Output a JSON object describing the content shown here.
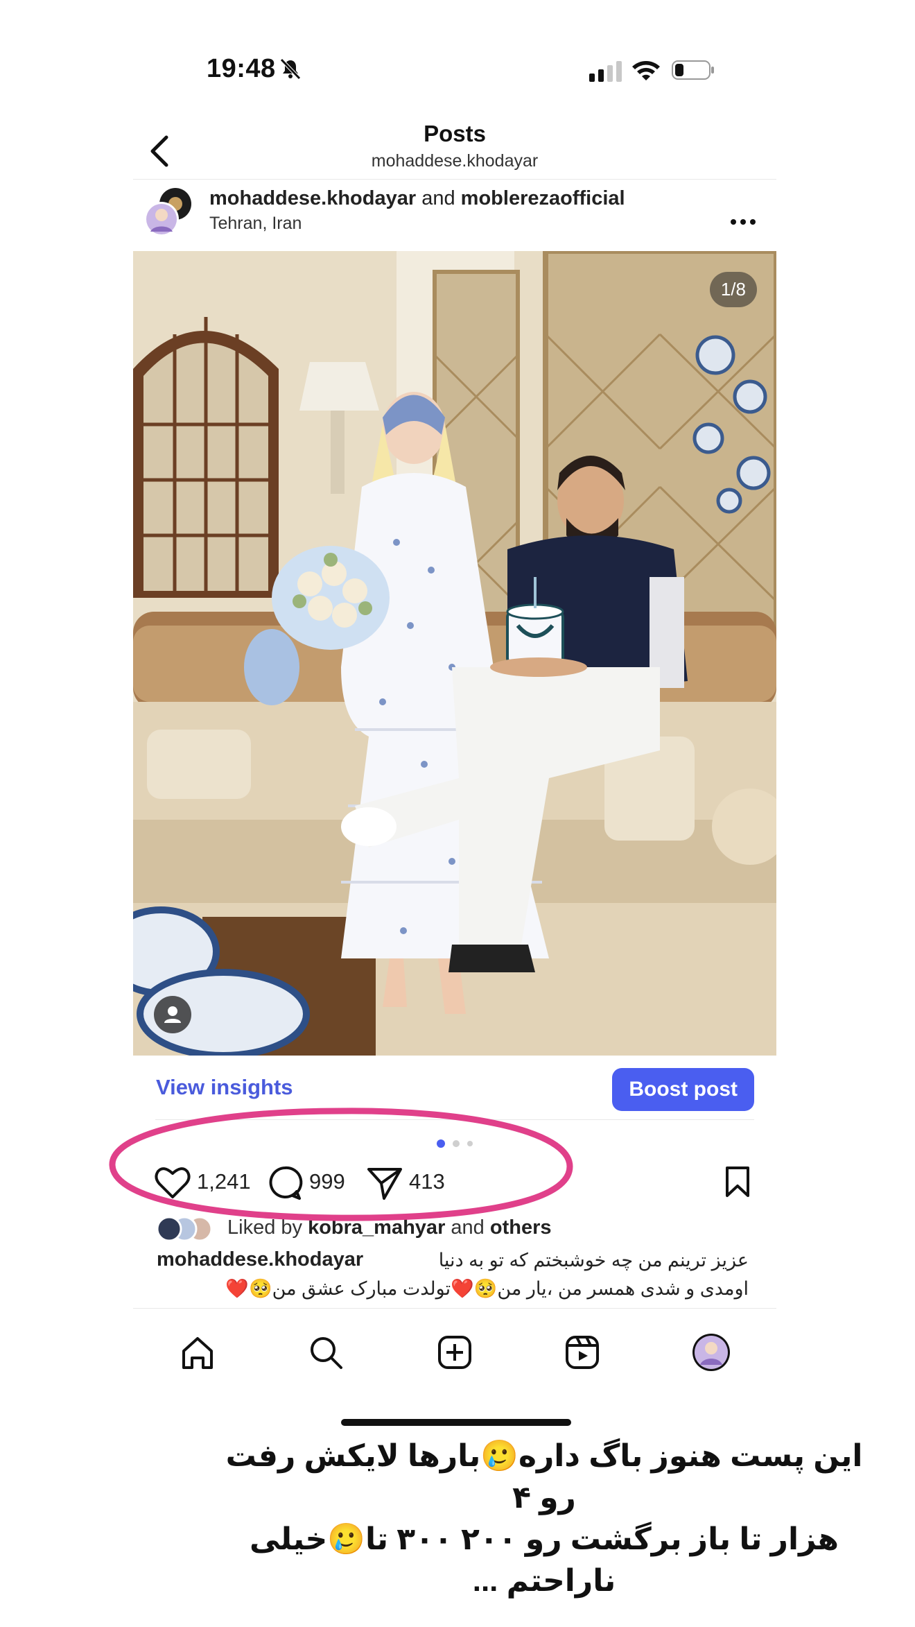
{
  "status": {
    "time": "19:48"
  },
  "header": {
    "title": "Posts",
    "subtitle": "mohaddese.khodayar"
  },
  "post": {
    "user": "mohaddese.khodayar",
    "joiner": "and",
    "collaborator": "moblerezaofficial",
    "location": "Tehran, Iran",
    "slide_counter": "1/8",
    "carousel": {
      "current": 1,
      "visible_dots": 3
    }
  },
  "insights_bar": {
    "view_insights": "View insights",
    "boost": "Boost post"
  },
  "actions": {
    "likes": "1,241",
    "comments": "999",
    "shares": "413"
  },
  "liked_by": {
    "prefix": "Liked by",
    "user": "kobra_mahyar",
    "joiner": "and",
    "others": "others"
  },
  "caption": {
    "user": "mohaddese.khodayar",
    "line1": "عزیز ترینم من چه خوشبختم که تو به دنیا",
    "line2": "اومدی و شدی همسر من ،یار من🥺❤️تولدت مبارک عشق من🥺❤️"
  },
  "tabbar": {
    "items": [
      "home-icon",
      "search-icon",
      "create-icon",
      "reels-icon",
      "profile-avatar"
    ]
  },
  "overlay": {
    "line1": "این پست هنوز باگ داره🥲بارها لایکش رفت رو ۴",
    "line2": "هزار تا باز برگشت رو ۲۰۰ ۳۰۰ تا🥲خیلی",
    "line3": "ناراحتم ..."
  },
  "colors": {
    "accent": "#4a5ef0",
    "link": "#4a5bdc",
    "annotation": "#e0408a"
  }
}
